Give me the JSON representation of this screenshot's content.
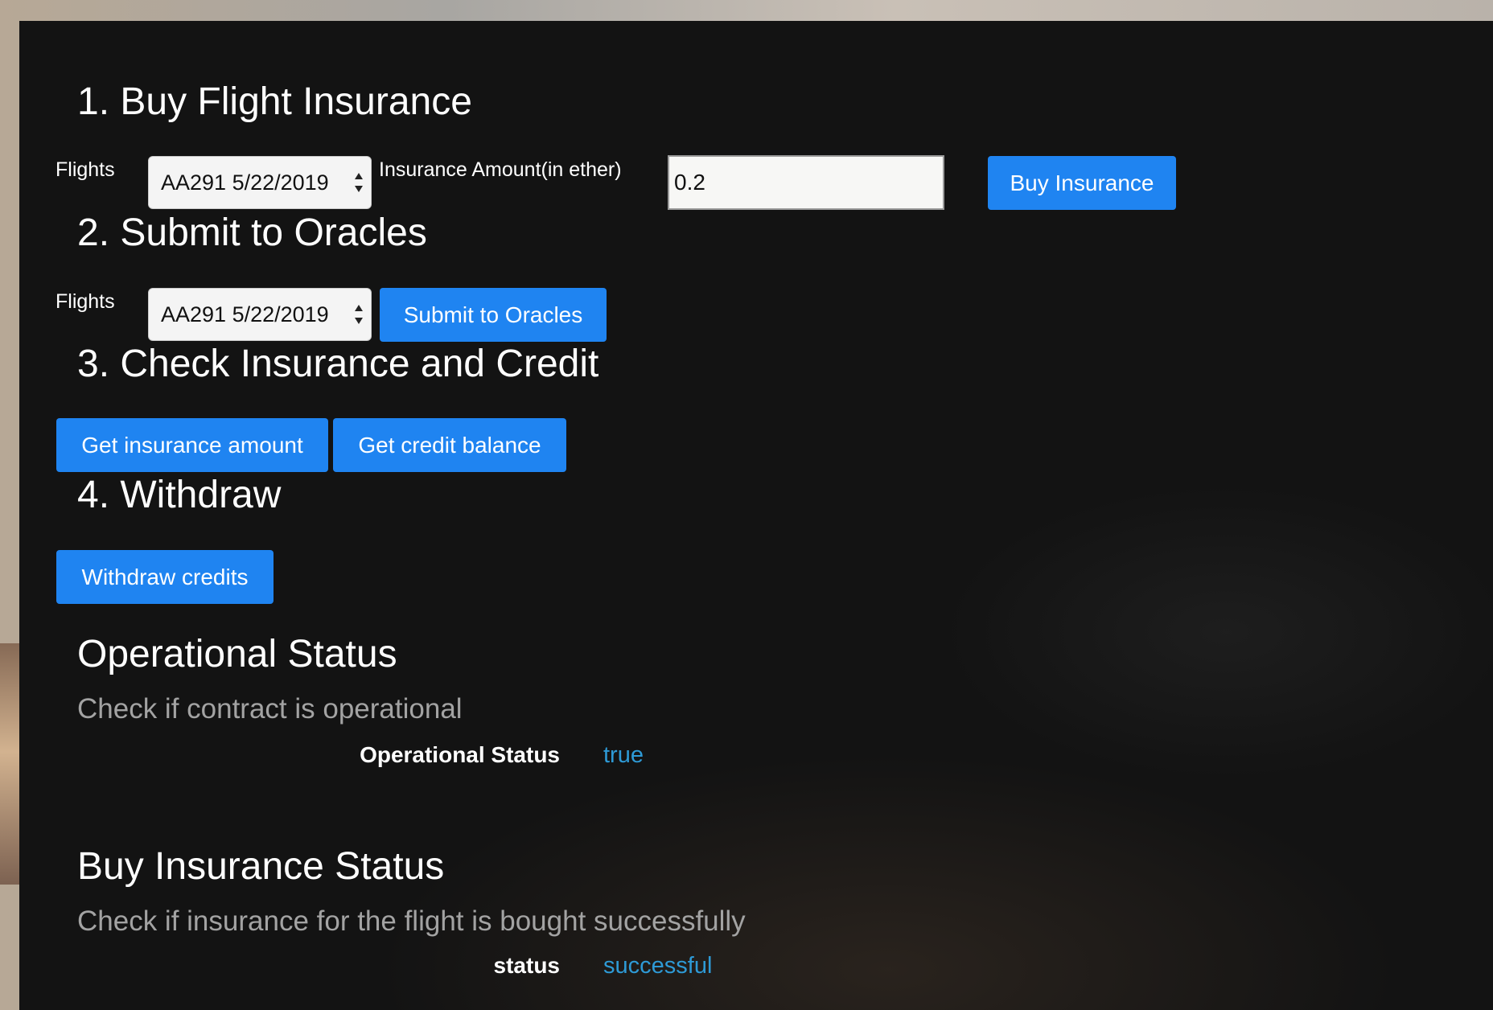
{
  "sections": {
    "buy": {
      "title": "1. Buy Flight Insurance",
      "flights_label": "Flights",
      "flight_selected": "AA291 5/22/2019",
      "amount_label": "Insurance Amount(in ether)",
      "amount_value": "0.2",
      "button_label": "Buy Insurance"
    },
    "submit": {
      "title": "2. Submit to Oracles",
      "flights_label": "Flights",
      "flight_selected": "AA291 5/22/2019",
      "button_label": "Submit to Oracles"
    },
    "check": {
      "title": "3. Check Insurance and Credit",
      "insurance_button_label": "Get insurance amount",
      "credit_button_label": "Get credit balance"
    },
    "withdraw": {
      "title": "4. Withdraw",
      "button_label": "Withdraw credits"
    }
  },
  "operational_status": {
    "title": "Operational Status",
    "subtitle": "Check if contract is operational",
    "label": "Operational Status",
    "value": "true"
  },
  "buy_insurance_status": {
    "title": "Buy Insurance Status",
    "subtitle": "Check if insurance for the flight is bought successfully",
    "label": "status",
    "value": "successful"
  },
  "colors": {
    "panel_background": "#131313",
    "button_blue": "#1f84f1",
    "status_value": "#2e9ad6",
    "subtitle_gray": "#a3a3a3"
  },
  "icons": {
    "select_arrows": "up-down-chevron-icon"
  }
}
